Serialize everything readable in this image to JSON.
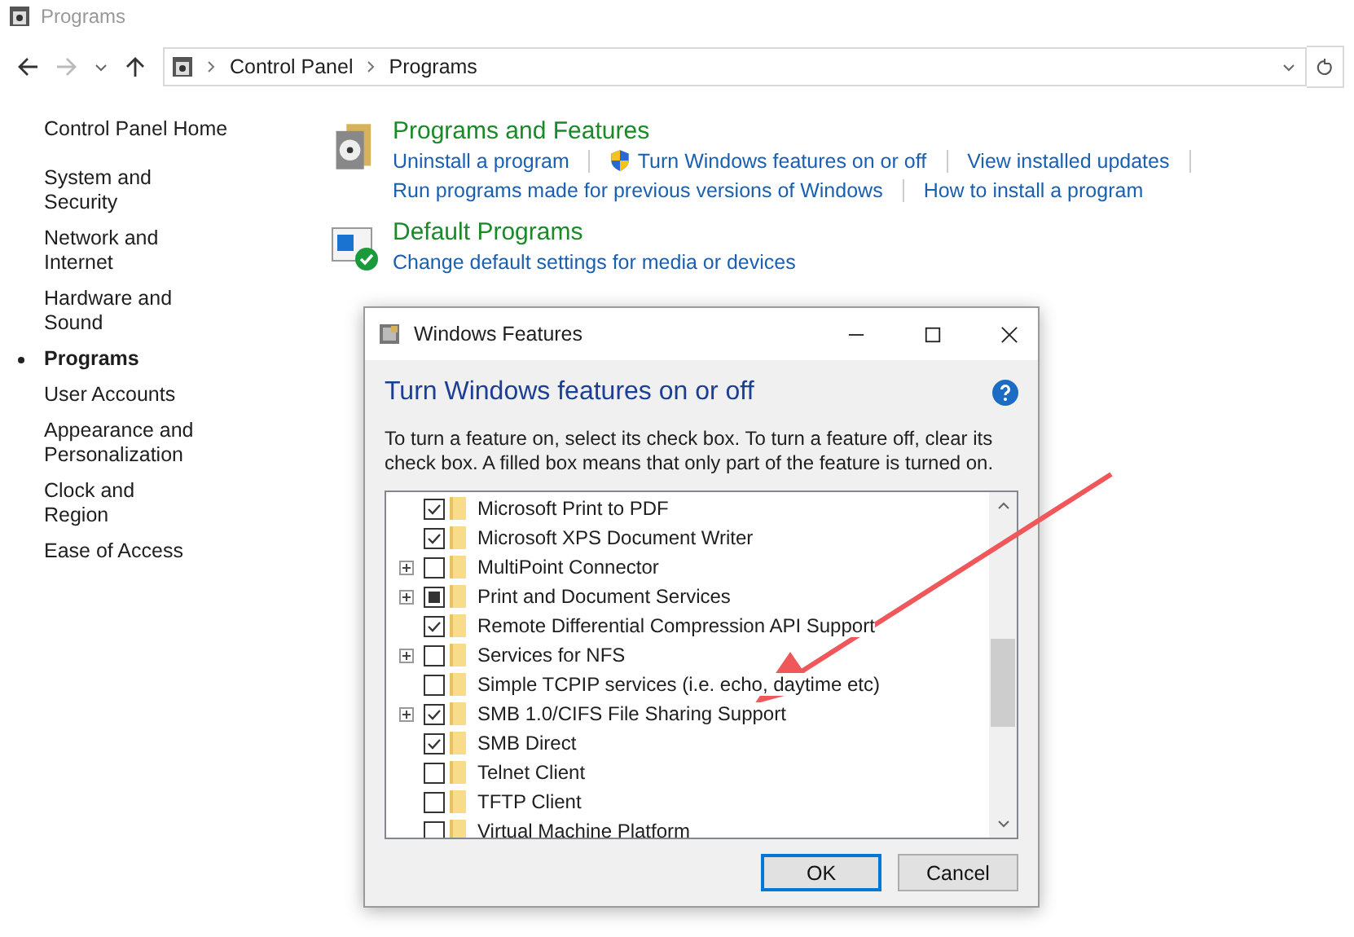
{
  "window": {
    "title": "Programs"
  },
  "address_bar": {
    "crumbs": [
      "Control Panel",
      "Programs"
    ]
  },
  "sidebar": {
    "home": "Control Panel Home",
    "items": [
      {
        "label": "System and Security",
        "selected": false
      },
      {
        "label": "Network and Internet",
        "selected": false
      },
      {
        "label": "Hardware and Sound",
        "selected": false
      },
      {
        "label": "Programs",
        "selected": true
      },
      {
        "label": "User Accounts",
        "selected": false
      },
      {
        "label": "Appearance and Personalization",
        "selected": false
      },
      {
        "label": "Clock and Region",
        "selected": false
      },
      {
        "label": "Ease of Access",
        "selected": false
      }
    ]
  },
  "sections": [
    {
      "kind": "programs",
      "title": "Programs and Features",
      "link_rows": [
        [
          {
            "label": "Uninstall a program",
            "shield": false
          },
          {
            "label": "Turn Windows features on or off",
            "shield": true
          },
          {
            "label": "View installed updates",
            "shield": false
          }
        ],
        [
          {
            "label": "Run programs made for previous versions of Windows",
            "shield": false
          },
          {
            "label": "How to install a program",
            "shield": false
          }
        ]
      ]
    },
    {
      "kind": "defaults",
      "title": "Default Programs",
      "link_rows": [
        [
          {
            "label": "Change default settings for media or devices",
            "shield": false
          }
        ]
      ]
    }
  ],
  "dialog": {
    "title": "Windows Features",
    "heading": "Turn Windows features on or off",
    "description": "To turn a feature on, select its check box. To turn a feature off, clear its check box. A filled box means that only part of the feature is turned on.",
    "features": [
      {
        "label": "Microsoft Print to PDF",
        "checked": true,
        "partial": false,
        "expandable": false
      },
      {
        "label": "Microsoft XPS Document Writer",
        "checked": true,
        "partial": false,
        "expandable": false
      },
      {
        "label": "MultiPoint Connector",
        "checked": false,
        "partial": false,
        "expandable": true
      },
      {
        "label": "Print and Document Services",
        "checked": false,
        "partial": true,
        "expandable": true
      },
      {
        "label": "Remote Differential Compression API Support",
        "checked": true,
        "partial": false,
        "expandable": false
      },
      {
        "label": "Services for NFS",
        "checked": false,
        "partial": false,
        "expandable": true
      },
      {
        "label": "Simple TCPIP services (i.e. echo, daytime etc)",
        "checked": false,
        "partial": false,
        "expandable": false
      },
      {
        "label": "SMB 1.0/CIFS File Sharing Support",
        "checked": true,
        "partial": false,
        "expandable": true
      },
      {
        "label": "SMB Direct",
        "checked": true,
        "partial": false,
        "expandable": false
      },
      {
        "label": "Telnet Client",
        "checked": false,
        "partial": false,
        "expandable": false
      },
      {
        "label": "TFTP Client",
        "checked": false,
        "partial": false,
        "expandable": false
      },
      {
        "label": "Virtual Machine Platform",
        "checked": false,
        "partial": false,
        "expandable": false
      }
    ],
    "buttons": [
      {
        "label": "OK",
        "default": true
      },
      {
        "label": "Cancel",
        "default": false
      }
    ]
  }
}
